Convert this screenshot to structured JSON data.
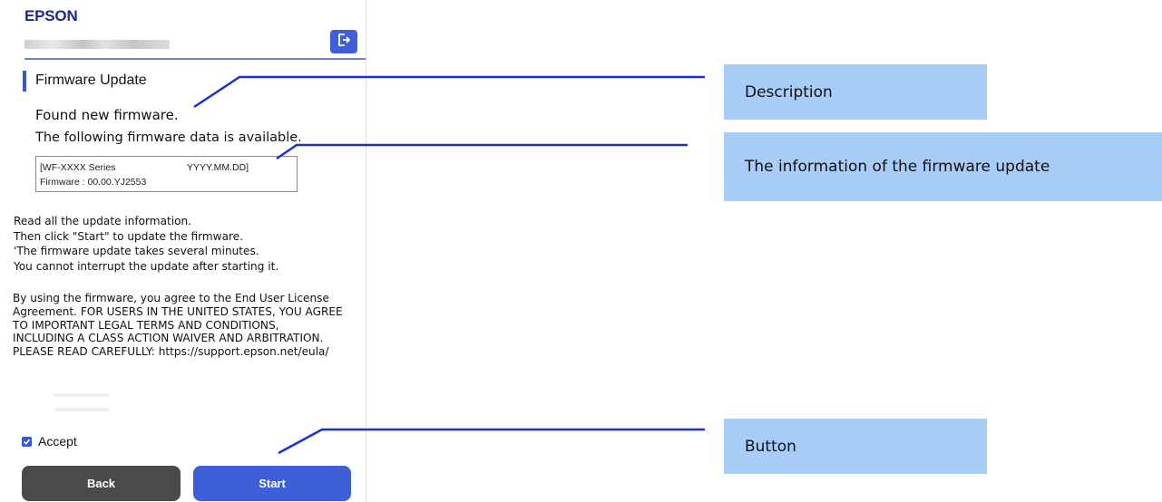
{
  "header": {
    "brand": "EPSON",
    "logout_icon": "logout-icon"
  },
  "section": {
    "title": "Firmware Update"
  },
  "main": {
    "found_text": "Found new firmware.",
    "following_text": "The following firmware data is available.",
    "firmware_box": {
      "series": "[WF-XXXX Series",
      "date": "YYYY.MM.DD]",
      "version": "Firmware : 00.00.YJ2553"
    },
    "info_lines": [
      "Read all the update information.",
      "Then click \"Start\" to update the firmware.",
      "'The firmware update takes several minutes.",
      "You cannot interrupt the update after starting it."
    ],
    "legal_lines": [
      "By using the firmware, you agree to the End User License",
      "Agreement. FOR USERS IN THE UNITED STATES, YOU AGREE",
      "TO IMPORTANT LEGAL TERMS AND CONDITIONS,",
      "INCLUDING A CLASS ACTION WAIVER AND ARBITRATION.",
      "PLEASE READ CAREFULLY: https://support.epson.net/eula/"
    ],
    "accept_label": "Accept",
    "accept_checked": true,
    "back_label": "Back",
    "start_label": "Start"
  },
  "callouts": {
    "description": "Description",
    "info": "The information of the firmware update",
    "button": "Button"
  },
  "colors": {
    "accent": "#3f5fd8",
    "callout_bg": "#a8cdf8",
    "leader_line": "#1a2fd6",
    "back_button": "#4a4a4a"
  }
}
